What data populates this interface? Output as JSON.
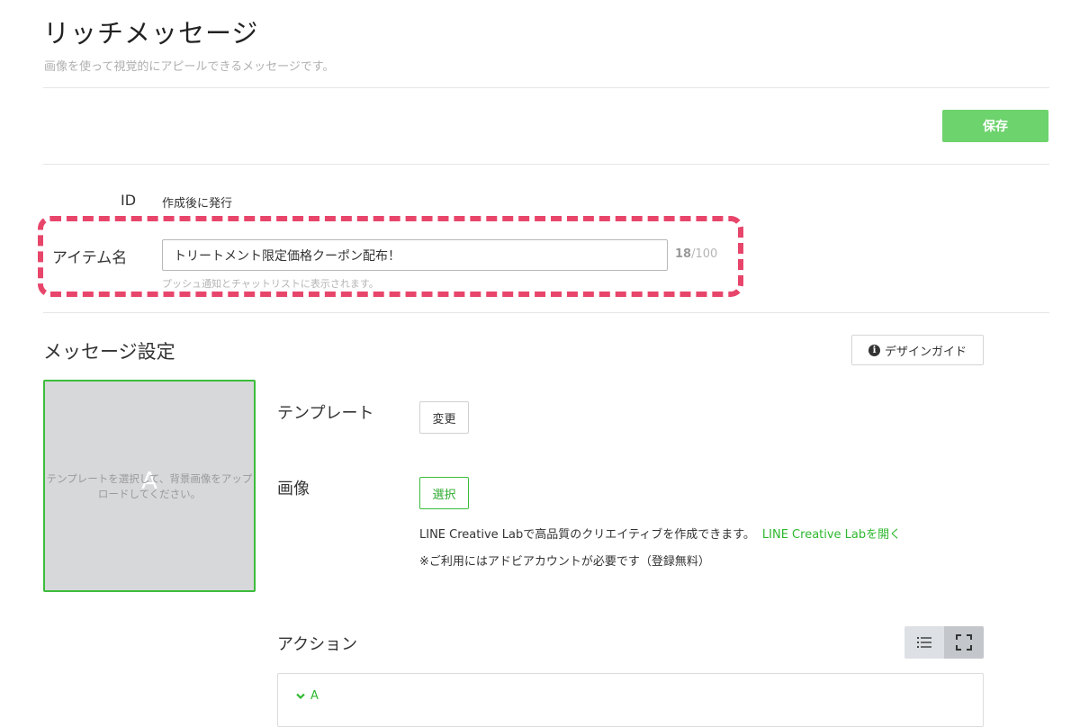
{
  "header": {
    "title": "リッチメッセージ",
    "subtitle": "画像を使って視覚的にアピールできるメッセージです。"
  },
  "toolbar": {
    "save_label": "保存"
  },
  "form": {
    "id_label": "ID",
    "id_value": "作成後に発行",
    "item_name_label": "アイテム名",
    "item_name_value": "トリートメント限定価格クーポン配布！",
    "counter_current": "18",
    "counter_max": "/100",
    "item_name_hint": "プッシュ通知とチャットリストに表示されます。"
  },
  "message_settings": {
    "title": "メッセージ設定",
    "design_guide_label": "デザインガイド",
    "preview_letter": "A",
    "preview_text_line1": "テンプレートを選択して、背景画像をアップ",
    "preview_text_line2": "ロードしてください。",
    "template_label": "テンプレート",
    "template_change_label": "変更",
    "image_label": "画像",
    "image_select_label": "選択",
    "lab_text": "LINE Creative Labで高品質のクリエイティブを作成できます。",
    "lab_link": "LINE Creative Labを開く",
    "note_text": "※ご利用にはアドビアカウントが必要です（登録無料）",
    "action_label": "アクション",
    "action_item_label": "A"
  },
  "icons": {
    "info": "info-circle-icon",
    "list": "list-icon",
    "fullscreen": "fullscreen-icon",
    "chevron": "chevron-down-icon"
  },
  "colors": {
    "accent": "#6dd36d",
    "link": "#2eb82e",
    "highlight": "#e8456b"
  }
}
